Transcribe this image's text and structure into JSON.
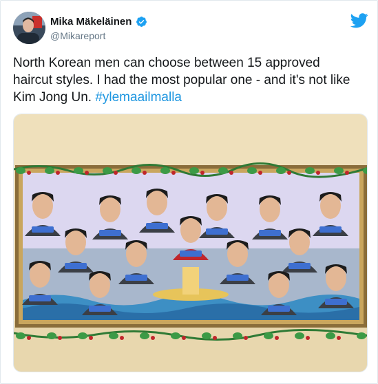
{
  "author": {
    "name": "Mika Mäkeläinen",
    "handle": "@Mikareport"
  },
  "tweet": {
    "text": "North Korean men can choose between 15 approved haircut styles. I had the most popular one - and it's not like Kim Jong Un. ",
    "hashtag": "#ylemaailmalla"
  },
  "icons": {
    "verified": "verified-badge-icon",
    "brand": "twitter-bird-icon"
  },
  "colors": {
    "text": "#14171a",
    "handle": "#657786",
    "link": "#1b95e0",
    "brand": "#1da1f2"
  }
}
